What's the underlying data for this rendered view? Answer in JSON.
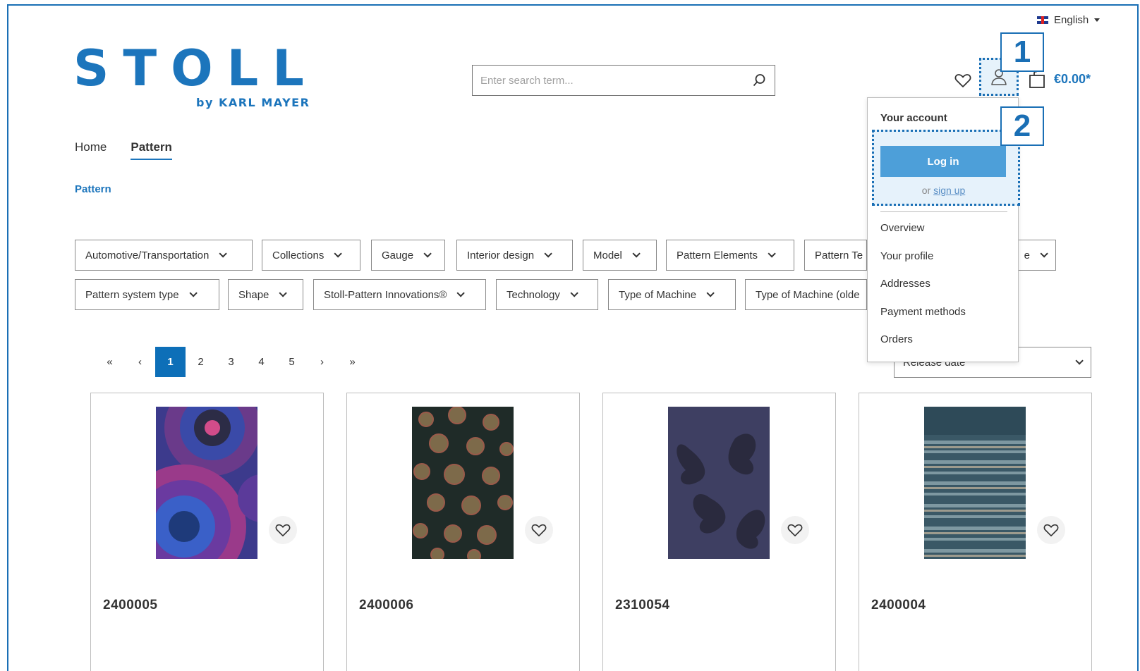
{
  "language": {
    "label": "English",
    "flag_icon": "uk-flag-icon"
  },
  "logo": {
    "main": "STOLL",
    "sub": "by KARL MAYER"
  },
  "search": {
    "placeholder": "Enter search term..."
  },
  "header": {
    "cart_total": "€0.00*"
  },
  "badges": [
    "1",
    "2"
  ],
  "nav": {
    "items": [
      "Home",
      "Pattern"
    ],
    "active": "Pattern"
  },
  "breadcrumb": "Pattern",
  "filters_row1": [
    "Automotive/Transportation",
    "Collections",
    "Gauge",
    "Interior design",
    "Model",
    "Pattern Elements",
    "Pattern Te",
    "e"
  ],
  "filters_row2": [
    "Pattern system type",
    "Shape",
    "Stoll-Pattern Innovations®",
    "Technology",
    "Type of Machine",
    "Type of Machine (olde"
  ],
  "pagination": {
    "first": "«",
    "prev": "‹",
    "pages": [
      "1",
      "2",
      "3",
      "4",
      "5"
    ],
    "current": "1",
    "next": "›",
    "last": "»"
  },
  "sort": {
    "value": "Release date"
  },
  "products": [
    {
      "name": "2400005"
    },
    {
      "name": "2400006"
    },
    {
      "name": "2310054"
    },
    {
      "name": "2400004"
    }
  ],
  "account_menu": {
    "title": "Your account",
    "login_label": "Log in",
    "or_text": "or",
    "signup_label": "sign up",
    "items": [
      "Overview",
      "Your profile",
      "Addresses",
      "Payment methods",
      "Orders"
    ]
  },
  "colors": {
    "brand": "#1c75bc",
    "highlight": "#1a6fb5",
    "login_button": "#4d9fd9",
    "current_page": "#0d6fb8"
  }
}
